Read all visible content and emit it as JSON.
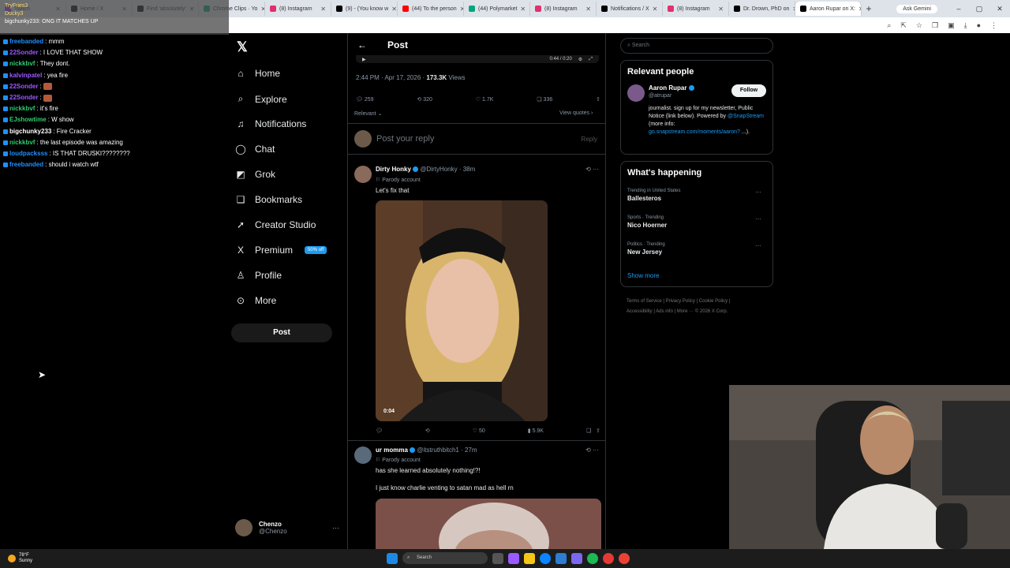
{
  "browser": {
    "tabs": [
      {
        "label": "Twitch",
        "color": "#9146ff",
        "active": false
      },
      {
        "label": "Home / X",
        "color": "#000000",
        "active": false
      },
      {
        "label": "Find 'absolutely'",
        "color": "#000000",
        "active": false
      },
      {
        "label": "Chrome Clips · Yo",
        "color": "#00a67e",
        "active": false
      },
      {
        "label": "(8) Instagram",
        "color": "#e1306c",
        "active": false
      },
      {
        "label": "(9) - (You know w",
        "color": "#000000",
        "active": false
      },
      {
        "label": "(44) To the person",
        "color": "#ff0000",
        "active": false
      },
      {
        "label": "(44) Polymarket",
        "color": "#00a67e",
        "active": false
      },
      {
        "label": "(8) Instagram",
        "color": "#e1306c",
        "active": false
      },
      {
        "label": "Notifications / X",
        "color": "#000000",
        "active": false
      },
      {
        "label": "(8) Instagram",
        "color": "#e1306c",
        "active": false
      },
      {
        "label": "Dr. Drown, PhD on",
        "color": "#000000",
        "active": false
      },
      {
        "label": "Aaron Rupar on X:",
        "color": "#000000",
        "active": true
      }
    ],
    "new_tab": "+",
    "ask_gemini": "Ask Gemini",
    "window_buttons": [
      "–",
      "▢",
      "✕"
    ]
  },
  "chat": {
    "header_lines": [
      "TryFries3",
      "Ducky3",
      "bigchunky233: ONG IT MATCHES UP"
    ],
    "messages": [
      {
        "user": "freebanded",
        "color": "#1e90ff",
        "text": ": mmm",
        "emote": false
      },
      {
        "user": "22Sonder",
        "color": "#9b59ff",
        "text": ": I LOVE THAT SHOW",
        "emote": false
      },
      {
        "user": "nickkbvf",
        "color": "#2ecc71",
        "text": ": They dont.",
        "emote": false
      },
      {
        "user": "kalvinpatel",
        "color": "#9b59ff",
        "text": ": yea fire",
        "emote": false
      },
      {
        "user": "22Sonder",
        "color": "#9b59ff",
        "text": ":",
        "emote": true
      },
      {
        "user": "22Sonder",
        "color": "#9b59ff",
        "text": ":",
        "emote": true
      },
      {
        "user": "nickkbvf",
        "color": "#2ecc71",
        "text": ": it's fire",
        "emote": false
      },
      {
        "user": "EJshowtime",
        "color": "#2ecc71",
        "text": ": W show",
        "emote": false
      },
      {
        "user": "bigchunky233",
        "color": "#ffffff",
        "text": ": Fire Cracker",
        "emote": false
      },
      {
        "user": "nickkbvf",
        "color": "#2ecc71",
        "text": ": the last episode was amazing",
        "emote": false
      },
      {
        "user": "loudpacksss",
        "color": "#1e90ff",
        "text": ": IS THAT DRUSKI????????",
        "emote": false
      },
      {
        "user": "freebanded",
        "color": "#1e90ff",
        "text": ": should i watch wtf",
        "emote": false
      }
    ]
  },
  "nav": {
    "items": [
      {
        "label": "Home",
        "icon": "⌂"
      },
      {
        "label": "Explore",
        "icon": "⌕"
      },
      {
        "label": "Notifications",
        "icon": "♫"
      },
      {
        "label": "Chat",
        "icon": "◯"
      },
      {
        "label": "Grok",
        "icon": "◩"
      },
      {
        "label": "Bookmarks",
        "icon": "❑"
      },
      {
        "label": "Creator Studio",
        "icon": "➚"
      },
      {
        "label": "Premium",
        "icon": "X"
      },
      {
        "label": "Profile",
        "icon": "♙"
      },
      {
        "label": "More",
        "icon": "⊙"
      }
    ],
    "premium_badge": "50% off",
    "post_button": "Post",
    "account": {
      "name": "Chenzo",
      "handle": "@Chenzo"
    }
  },
  "feed": {
    "header_title": "Post",
    "video_time": "0:44 / 0:20",
    "meta_time": "2:44 PM · Apr 17, 2026 · ",
    "meta_views": "173.3K",
    "meta_views_label": " Views",
    "stats": {
      "replies": "259",
      "reposts": "320",
      "likes": "1.7K",
      "bookmarks": "336"
    },
    "relevant_label": "Relevant",
    "view_quotes": "View quotes",
    "reply_placeholder": "Post your reply",
    "reply_button": "Reply",
    "tweets": [
      {
        "name": "Dirty Honky",
        "handle": "@DirtyHonky · 38m",
        "parody": "Parody account",
        "text": "Let's fix that",
        "duration": "0:04",
        "likes": "50",
        "views": "5.9K"
      },
      {
        "name": "ur momma",
        "handle": "@itstruthbitch1 · 27m",
        "parody": "Parody account",
        "text": "has she learned absolutely nothing!?!",
        "text2": "I just know charlie venting to satan mad as hell rn"
      }
    ]
  },
  "right": {
    "search_placeholder": "Search",
    "relevant_title": "Relevant people",
    "person": {
      "name": "Aaron Rupar",
      "handle": "@atrupar",
      "follow": "Follow",
      "bio_1": "journalist. sign up for my newsletter, Public Notice (link below). Powered by ",
      "bio_link1": "@SnapStream",
      "bio_2": " (more info: ",
      "bio_link2": "go.snapstream.com/moments/aaron?",
      "bio_3": " ...)."
    },
    "happening_title": "What's happening",
    "trends": [
      {
        "context": "Trending in United States",
        "title": "Ballesteros"
      },
      {
        "context": "Sports · Trending",
        "title": "Nico Hoerner"
      },
      {
        "context": "Politics · Trending",
        "title": "New Jersey"
      }
    ],
    "show_more": "Show more",
    "footer_1": "Terms of Service  |  Privacy Policy  |  Cookie Policy  |",
    "footer_2": "Accessibility  |  Ads info  |  More ···  © 2026 X Corp."
  },
  "taskbar": {
    "temp": "78°F",
    "condition": "Sunny",
    "search": "Search"
  }
}
